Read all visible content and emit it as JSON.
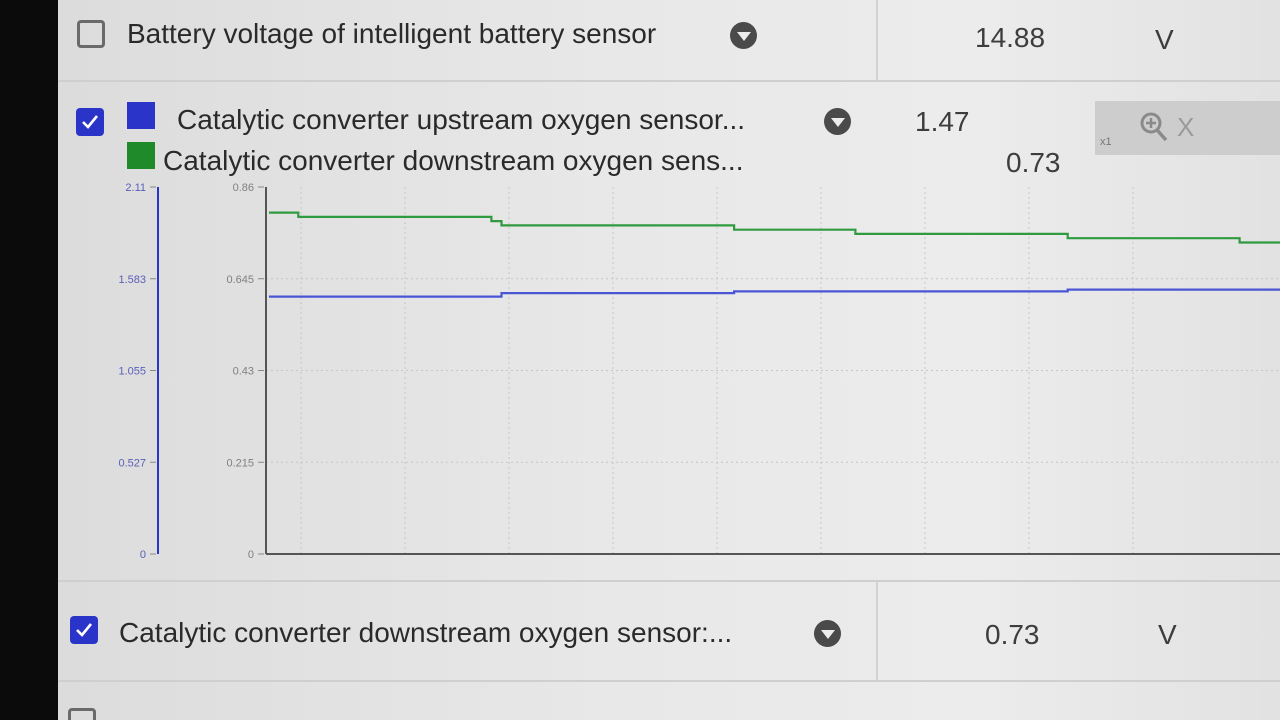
{
  "rows": [
    {
      "label": "Battery voltage of intelligent battery sensor",
      "value": "14.88",
      "unit": "V",
      "checked": false
    },
    {
      "label": "Catalytic converter downstream oxygen sensor:...",
      "value": "0.73",
      "unit": "V",
      "checked": true
    }
  ],
  "graph": {
    "series": [
      {
        "name": "Catalytic converter upstream oxygen sensor...",
        "value": "1.47",
        "color": "#2b34c9"
      },
      {
        "name": "Catalytic converter downstream oxygen sens...",
        "value": "0.73",
        "color": "#1f8a2a"
      }
    ],
    "zoom": {
      "level_label": "x1",
      "close_label": "X"
    }
  },
  "chart_data": {
    "type": "line",
    "axes": [
      {
        "ticks": [
          "2.11",
          "1.583",
          "1.055",
          "0.527",
          "0"
        ],
        "ylim": [
          0,
          2.11
        ],
        "color": "#2b34c9"
      },
      {
        "ticks": [
          "0.86",
          "0.645",
          "0.43",
          "0.215",
          "0"
        ],
        "ylim": [
          0,
          0.86
        ],
        "color": "#707070"
      }
    ],
    "x": [
      0,
      2.9,
      9.7,
      22,
      23,
      24,
      34,
      46,
      57,
      58,
      78,
      79,
      95,
      96,
      100
    ],
    "series": [
      {
        "values": [
          1.48,
          1.48,
          1.48,
          1.48,
          1.5,
          1.5,
          1.5,
          1.51,
          1.51,
          1.51,
          1.51,
          1.52,
          1.52,
          1.52,
          1.52
        ],
        "color": "#4a55d6"
      },
      {
        "values": [
          0.8,
          0.79,
          0.79,
          0.78,
          0.77,
          0.77,
          0.77,
          0.76,
          0.76,
          0.75,
          0.75,
          0.74,
          0.74,
          0.73,
          0.73
        ],
        "color": "#2f9a3f"
      }
    ]
  }
}
